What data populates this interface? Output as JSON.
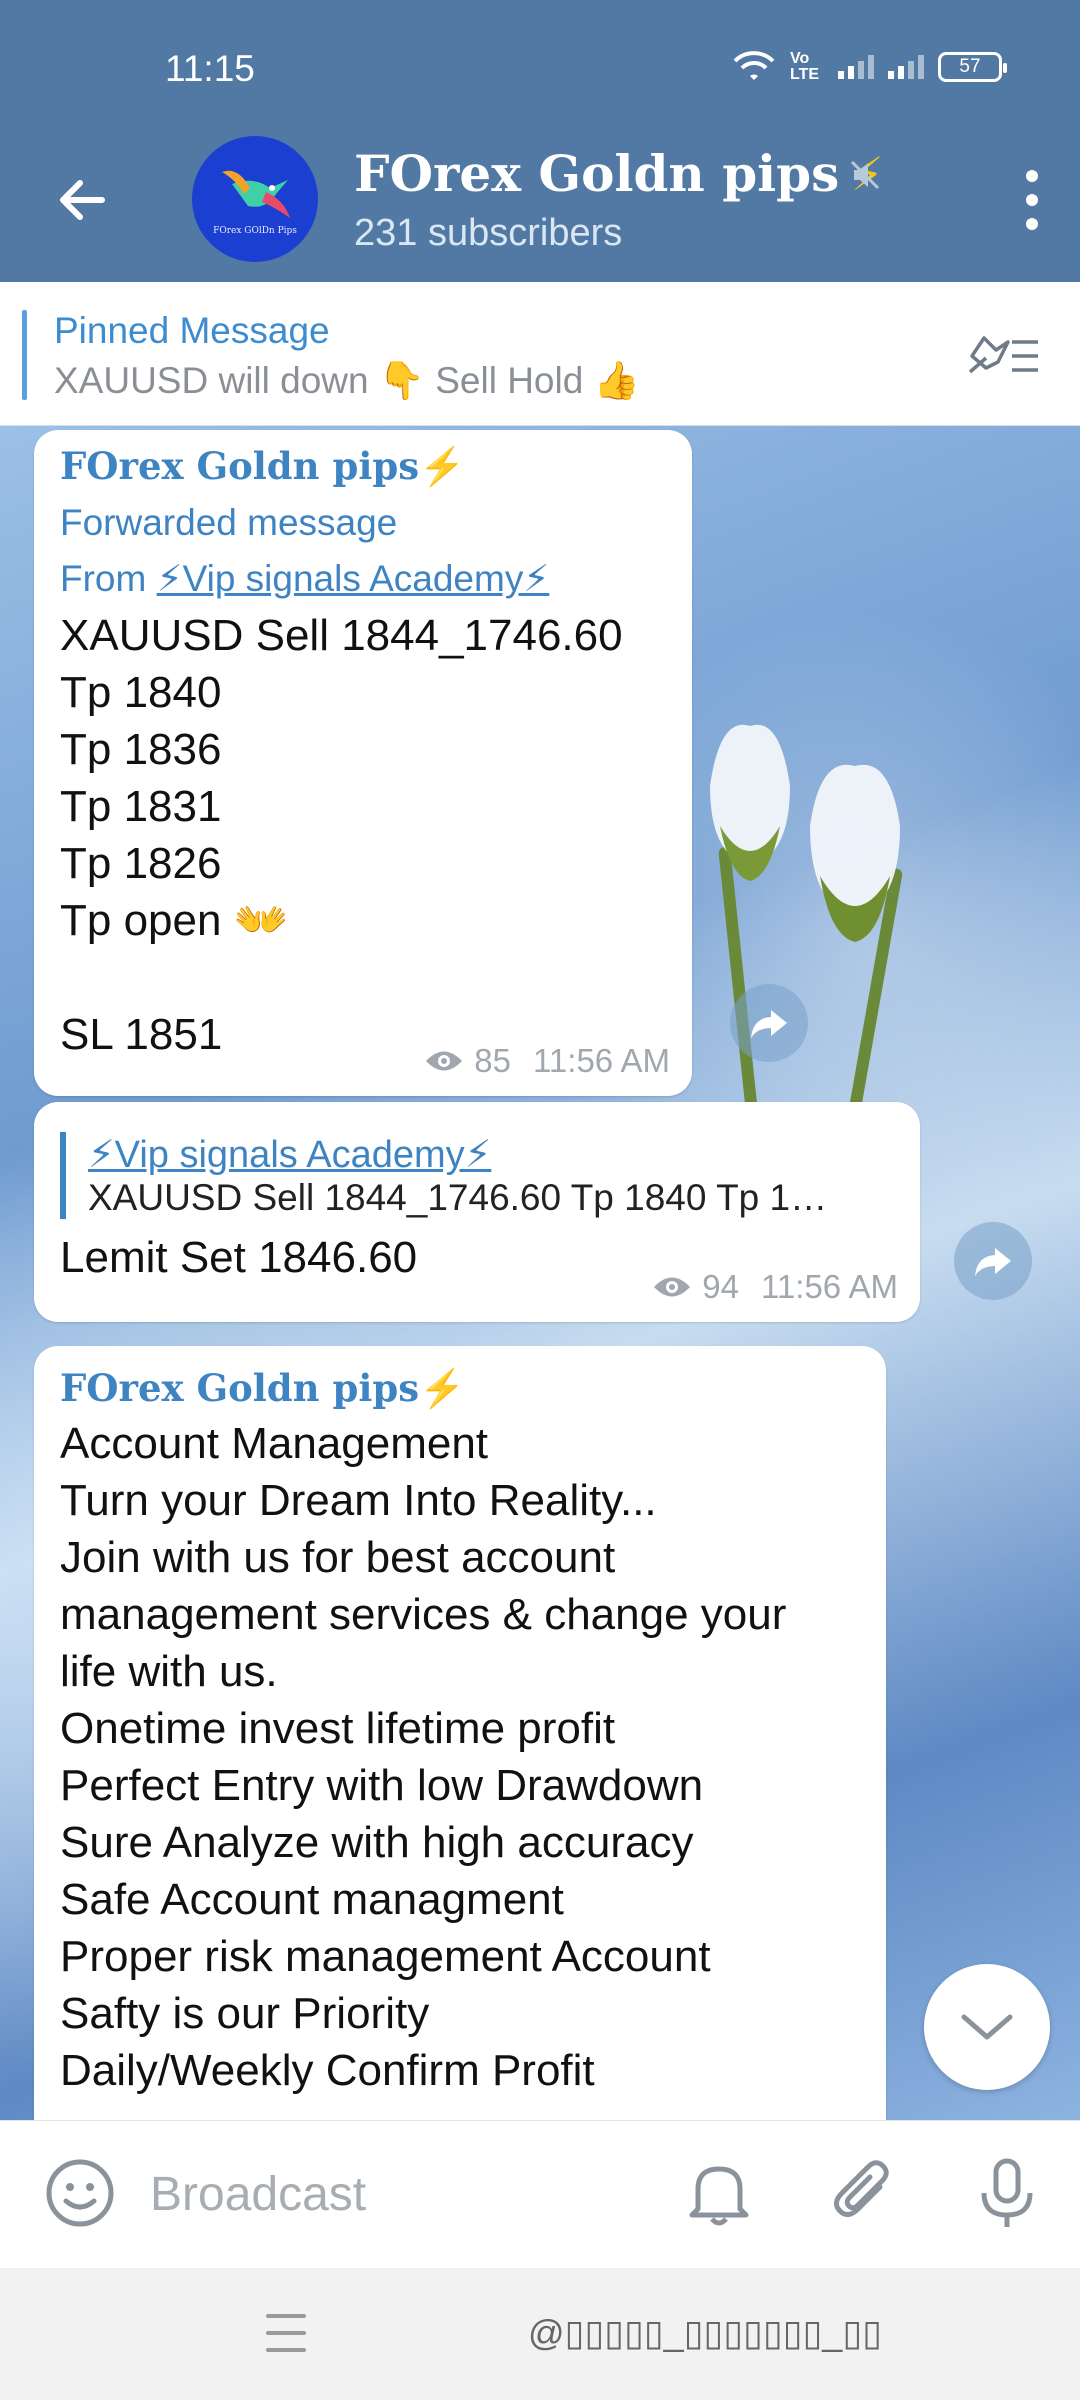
{
  "status_bar": {
    "time": "11:15",
    "network": "Vo LTE",
    "battery": "57"
  },
  "header": {
    "channel_name": "FOrex Goldn pips",
    "channel_emoji": "⚡",
    "subscribers": "231 subscribers",
    "avatar_caption": "FOrex GOlDn Pips"
  },
  "pinned": {
    "title": "Pinned Message",
    "text": "XAUUSD will down 👇 Sell Hold 👍"
  },
  "messages": [
    {
      "sender": "FOrex Goldn pips⚡",
      "forwarded_label": "Forwarded message",
      "from_prefix": "From ",
      "from_name": "⚡Vip signals Academy⚡",
      "lines": [
        "XAUUSD Sell 1844_1746.60",
        "Tp 1840",
        "Tp 1836",
        "Tp 1831",
        "Tp 1826",
        "Tp open 👐",
        "",
        "SL 1851"
      ],
      "views": "85",
      "time": "11:56 AM"
    },
    {
      "reply_name": "⚡Vip signals Academy⚡",
      "reply_text": "XAUUSD Sell 1844_1746.60 Tp 1840 Tp 1…",
      "text": "Lemit Set 1846.60",
      "views": "94",
      "time": "11:56 AM"
    },
    {
      "sender": "FOrex Goldn pips⚡",
      "lines": [
        "Account Management",
        "Turn your Dream Into Reality...",
        "Join with us for best account",
        "management services & change your",
        "life with us.",
        "Onetime invest lifetime profit",
        "Perfect Entry with low Drawdown",
        "Sure Analyze with high accuracy",
        "Safe Account managment",
        "Proper risk management Account",
        "Safty is our Priority",
        "Daily/Weekly Confirm Profit"
      ]
    }
  ],
  "input": {
    "placeholder": "Broadcast"
  },
  "navbar": {
    "watermark": "@▯▯▯▯▯_▯▯▯▯▯▯▯_▯▯"
  }
}
